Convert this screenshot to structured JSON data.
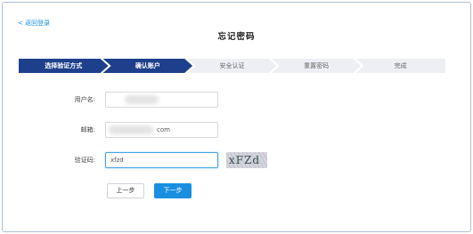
{
  "nav": {
    "back_label": "< 返回登录"
  },
  "page": {
    "title": "忘记密码"
  },
  "steps": [
    {
      "label": "选择验证方式",
      "active": true
    },
    {
      "label": "确认账户",
      "active": true
    },
    {
      "label": "安全认证",
      "active": false
    },
    {
      "label": "重置密码",
      "active": false
    },
    {
      "label": "完成",
      "active": false
    }
  ],
  "form": {
    "username": {
      "label": "用户名:",
      "value": ""
    },
    "email": {
      "label": "邮箱:",
      "value": "com"
    },
    "captcha": {
      "label": "验证码:",
      "value": "xfzd",
      "image_text": "xFZd"
    }
  },
  "buttons": {
    "prev_label": "上一步",
    "next_label": "下一步"
  },
  "colors": {
    "step_active": "#1e3f8c",
    "step_inactive": "#eeeff4",
    "primary": "#1a8fe0",
    "link": "#1a8fe0"
  }
}
